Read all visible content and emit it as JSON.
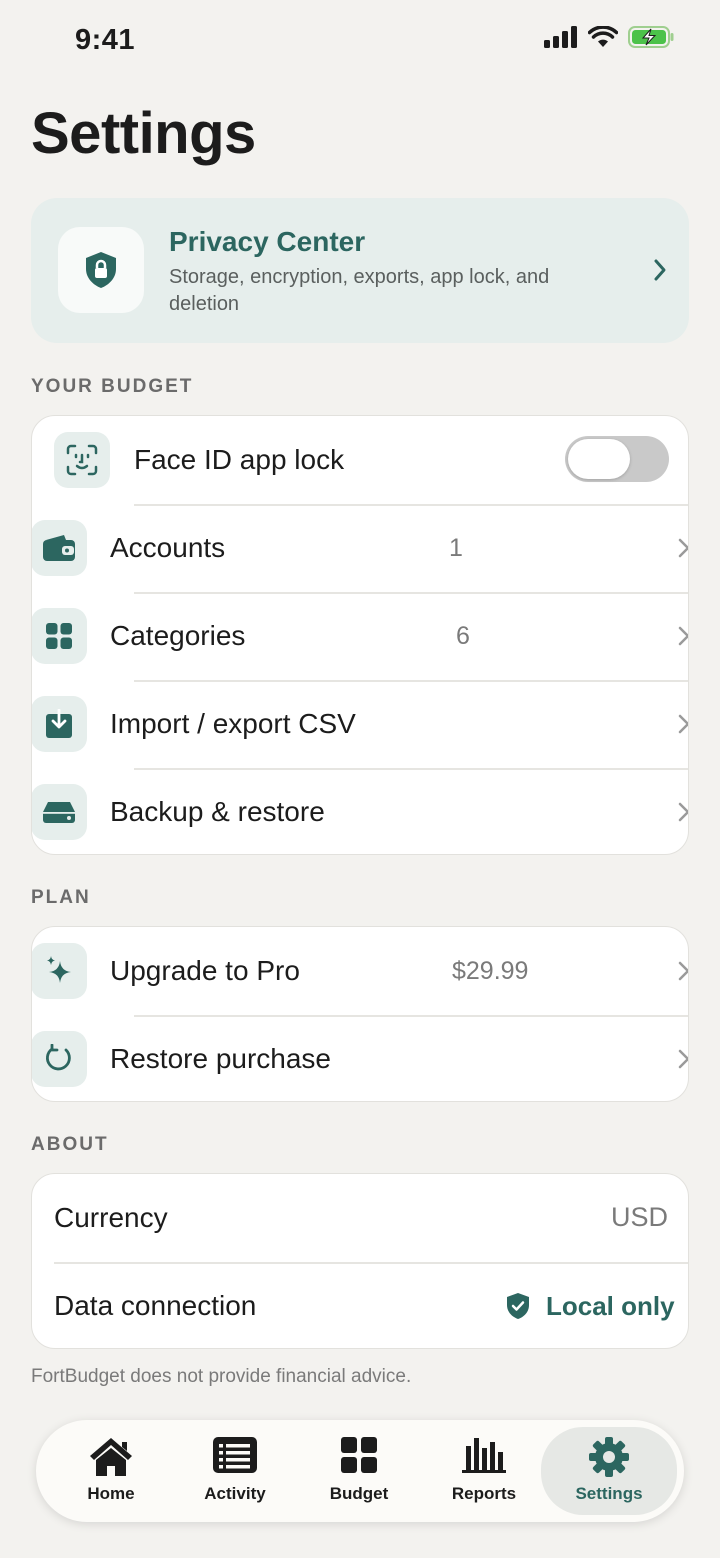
{
  "status_bar": {
    "time": "9:41"
  },
  "page_title": "Settings",
  "privacy_center": {
    "title": "Privacy Center",
    "description": "Storage, encryption, exports, app lock, and deletion"
  },
  "sections": {
    "budget": {
      "label": "YOUR BUDGET",
      "face_id": {
        "label": "Face ID app lock",
        "enabled": false
      },
      "accounts": {
        "label": "Accounts",
        "value": "1"
      },
      "categories": {
        "label": "Categories",
        "value": "6"
      },
      "import_export": {
        "label": "Import / export CSV"
      },
      "backup": {
        "label": "Backup & restore"
      }
    },
    "plan": {
      "label": "PLAN",
      "upgrade": {
        "label": "Upgrade to Pro",
        "value": "$29.99"
      },
      "restore": {
        "label": "Restore purchase"
      }
    },
    "about": {
      "label": "ABOUT",
      "currency": {
        "label": "Currency",
        "value": "USD"
      },
      "data_connection": {
        "label": "Data connection",
        "value": "Local only"
      }
    }
  },
  "footer_note": "FortBudget does not provide financial advice.",
  "tabs": [
    {
      "label": "Home",
      "icon": "house-icon"
    },
    {
      "label": "Activity",
      "icon": "list-icon"
    },
    {
      "label": "Budget",
      "icon": "grid-icon"
    },
    {
      "label": "Reports",
      "icon": "bar-chart-icon"
    },
    {
      "label": "Settings",
      "icon": "gear-icon",
      "active": true
    }
  ],
  "colors": {
    "accent": "#2c6660",
    "background": "#f3f2ef",
    "icon_tile": "#e6eeec"
  }
}
